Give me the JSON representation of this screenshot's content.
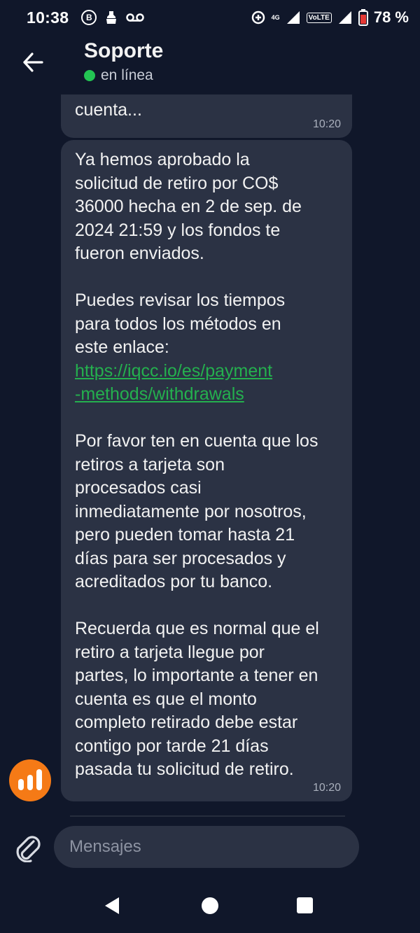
{
  "status_bar": {
    "time": "10:38",
    "network_label": "4G",
    "volte_label": "VoLTE",
    "battery": "78 %"
  },
  "header": {
    "title": "Soporte",
    "status": "en línea",
    "status_color": "#23c553"
  },
  "messages": [
    {
      "text": "cuenta...",
      "time": "10:20"
    },
    {
      "text_p1": "Ya hemos aprobado la\nsolicitud de retiro por CO$\n36000 hecha en 2 de sep. de\n2024 21:59 y los fondos te\nfueron enviados.\n\nPuedes revisar los tiempos\npara todos los métodos en\neste enlace:\n",
      "link_line1": "https://iqcc.io/es/payment",
      "link_line2": "-methods/withdrawals",
      "text_p2": "\n\nPor favor ten en cuenta que los\nretiros a tarjeta son\nprocesados casi\ninmediatamente por nosotros,\npero pueden tomar hasta 21\ndías para ser procesados y\nacreditados por tu banco.\n\nRecuerda que es normal que el\nretiro a tarjeta llegue por\npartes, lo importante a tener en\ncuenta es que el monto\ncompleto retirado debe estar\ncontigo por tarde 21 días\npasada tu solicitud de retiro.",
      "time": "10:20"
    }
  ],
  "composer": {
    "placeholder": "Mensajes"
  },
  "icons": {
    "back": "arrow-left-icon",
    "attach": "paperclip-icon",
    "avatar": "chart-bars-logo"
  },
  "colors": {
    "background": "#10172a",
    "bubble": "#2b3244",
    "link": "#24b04e",
    "avatar": "#f57a16"
  }
}
